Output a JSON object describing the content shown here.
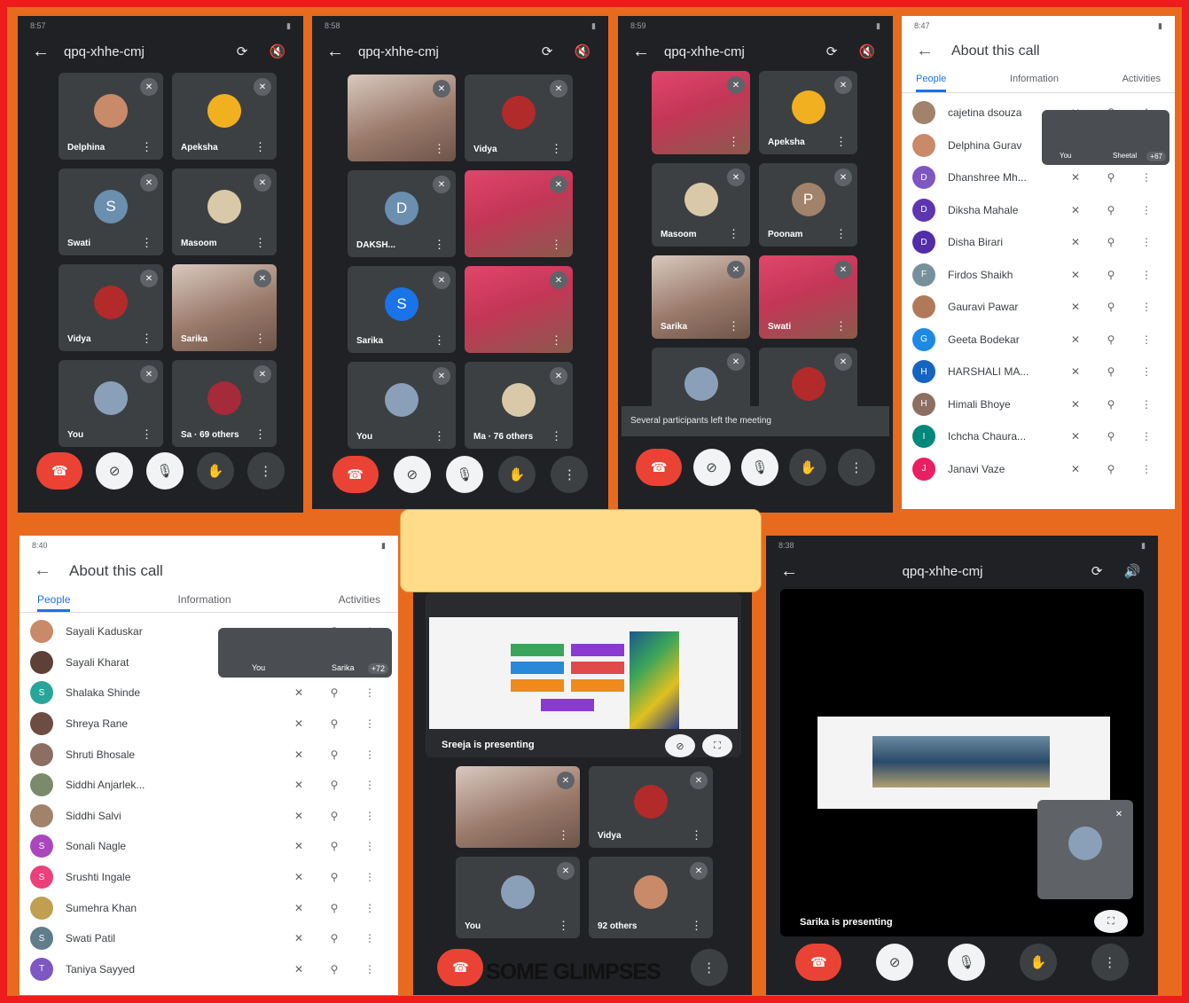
{
  "meeting_code": "qpq-xhhe-cmj",
  "caption": "SOME GLIMPSES",
  "status_times": [
    "8:57",
    "8:58",
    "8:59",
    "8:47",
    "8:40",
    "8:38"
  ],
  "about": {
    "title": "About this call",
    "tabs": [
      "People",
      "Information",
      "Activities"
    ]
  },
  "panel1": {
    "tiles": [
      {
        "name": "Delphina",
        "type": "avatar",
        "color": "#c98a6a",
        "letter": ""
      },
      {
        "name": "Apeksha",
        "type": "avatar",
        "color": "#f0b020",
        "letter": ""
      },
      {
        "name": "Swati",
        "type": "avatar",
        "color": "#6b8fae",
        "letter": "S"
      },
      {
        "name": "Masoom",
        "type": "avatar",
        "color": "#d9c9a8",
        "letter": ""
      },
      {
        "name": "Vidya",
        "type": "avatar",
        "color": "#b32a2a",
        "letter": ""
      },
      {
        "name": "Sarika",
        "type": "video",
        "color": "#9a7b6b",
        "letter": ""
      },
      {
        "name": "You",
        "type": "avatar",
        "color": "#8aa0b8",
        "letter": ""
      },
      {
        "name": "Sa · 69 others",
        "type": "avatar",
        "color": "#a52a3a",
        "letter": ""
      }
    ]
  },
  "panel2": {
    "tiles": [
      {
        "name": "",
        "type": "video",
        "color": "#d8c8bf",
        "letter": ""
      },
      {
        "name": "Vidya",
        "type": "avatar",
        "color": "#b32a2a",
        "letter": ""
      },
      {
        "name": "DAKSH...",
        "type": "avatar",
        "color": "#6b8fae",
        "letter": "D"
      },
      {
        "name": "",
        "type": "video",
        "color": "#e0466b",
        "letter": ""
      },
      {
        "name": "Sarika",
        "type": "avatar",
        "color": "#1a73e8",
        "letter": "S"
      },
      {
        "name": "",
        "type": "video",
        "color": "#e0466b",
        "letter": ""
      },
      {
        "name": "You",
        "type": "avatar",
        "color": "#8aa0b8",
        "letter": ""
      },
      {
        "name": "Ma · 76 others",
        "type": "avatar",
        "color": "#d9c9a8",
        "letter": ""
      }
    ]
  },
  "panel3": {
    "tiles": [
      {
        "name": "",
        "type": "video",
        "color": "#e0466b",
        "letter": ""
      },
      {
        "name": "Apeksha",
        "type": "avatar",
        "color": "#f0b020",
        "letter": ""
      },
      {
        "name": "Masoom",
        "type": "avatar",
        "color": "#d9c9a8",
        "letter": ""
      },
      {
        "name": "Poonam",
        "type": "avatar",
        "color": "#a1826a",
        "letter": "P"
      },
      {
        "name": "Sarika",
        "type": "video",
        "color": "#9a7b6b",
        "letter": ""
      },
      {
        "name": "Swati",
        "type": "video",
        "color": "#e0466b",
        "letter": ""
      },
      {
        "name": "",
        "type": "avatar",
        "color": "#8aa0b8",
        "letter": ""
      },
      {
        "name": "",
        "type": "avatar",
        "color": "#b32a2a",
        "letter": ""
      }
    ],
    "notice": "Several participants left the meeting"
  },
  "panel4": {
    "people": [
      {
        "name": "cajetina dsouza",
        "color": "#a1826a",
        "letter": ""
      },
      {
        "name": "Delphina Gurav",
        "color": "#c98a6a",
        "letter": ""
      },
      {
        "name": "Dhanshree Mh...",
        "color": "#7e57c2",
        "letter": "D"
      },
      {
        "name": "Diksha Mahale",
        "color": "#5e35b1",
        "letter": "D"
      },
      {
        "name": "Disha Birari",
        "color": "#512da8",
        "letter": "D"
      },
      {
        "name": "Firdos Shaikh",
        "color": "#78909c",
        "letter": "F"
      },
      {
        "name": "Gauravi Pawar",
        "color": "#b07a5a",
        "letter": ""
      },
      {
        "name": "Geeta Bodekar",
        "color": "#1e88e5",
        "letter": "G"
      },
      {
        "name": "HARSHALI MA...",
        "color": "#1565c0",
        "letter": "H"
      },
      {
        "name": "Himali Bhoye",
        "color": "#8d6e63",
        "letter": "H"
      },
      {
        "name": "Ichcha Chaura...",
        "color": "#00897b",
        "letter": "I"
      },
      {
        "name": "Janavi Vaze",
        "color": "#e91e63",
        "letter": "J"
      }
    ],
    "pip_labels": [
      "You",
      "Sheetal",
      "+67"
    ]
  },
  "panel5": {
    "people": [
      {
        "name": "Sayali Kaduskar",
        "color": "#c98a6a",
        "letter": ""
      },
      {
        "name": "Sayali Kharat",
        "color": "#5d4037",
        "letter": ""
      },
      {
        "name": "Shalaka Shinde",
        "color": "#26a69a",
        "letter": "S"
      },
      {
        "name": "Shreya Rane",
        "color": "#6d4c41",
        "letter": ""
      },
      {
        "name": "Shruti Bhosale",
        "color": "#8d6e63",
        "letter": ""
      },
      {
        "name": "Siddhi Anjarlek...",
        "color": "#7a8a6a",
        "letter": ""
      },
      {
        "name": "Siddhi Salvi",
        "color": "#a1826a",
        "letter": ""
      },
      {
        "name": "Sonali Nagle",
        "color": "#ab47bc",
        "letter": "S"
      },
      {
        "name": "Srushti Ingale",
        "color": "#ec407a",
        "letter": "S"
      },
      {
        "name": "Sumehra Khan",
        "color": "#c0a050",
        "letter": ""
      },
      {
        "name": "Swati Patil",
        "color": "#607d8b",
        "letter": "S"
      },
      {
        "name": "Taniya Sayyed",
        "color": "#7e57c2",
        "letter": "T"
      }
    ],
    "pip_labels": [
      "You",
      "Sarika",
      "+72"
    ]
  },
  "panel6": {
    "presenting": "Sreeja is presenting",
    "tiles": [
      {
        "name": "",
        "type": "video",
        "color": "#9a7b6b",
        "letter": ""
      },
      {
        "name": "Vidya",
        "type": "avatar",
        "color": "#b32a2a",
        "letter": ""
      },
      {
        "name": "You",
        "type": "avatar",
        "color": "#8aa0b8",
        "letter": ""
      },
      {
        "name": "92 others",
        "type": "avatar",
        "color": "#c98a6a",
        "letter": ""
      }
    ]
  },
  "panel7": {
    "presenting": "Sarika is presenting"
  },
  "icons": {
    "back": "←",
    "mute": "✕",
    "more": "⋮",
    "end_call": "☎",
    "hand": "✋",
    "pin": "⚲"
  }
}
